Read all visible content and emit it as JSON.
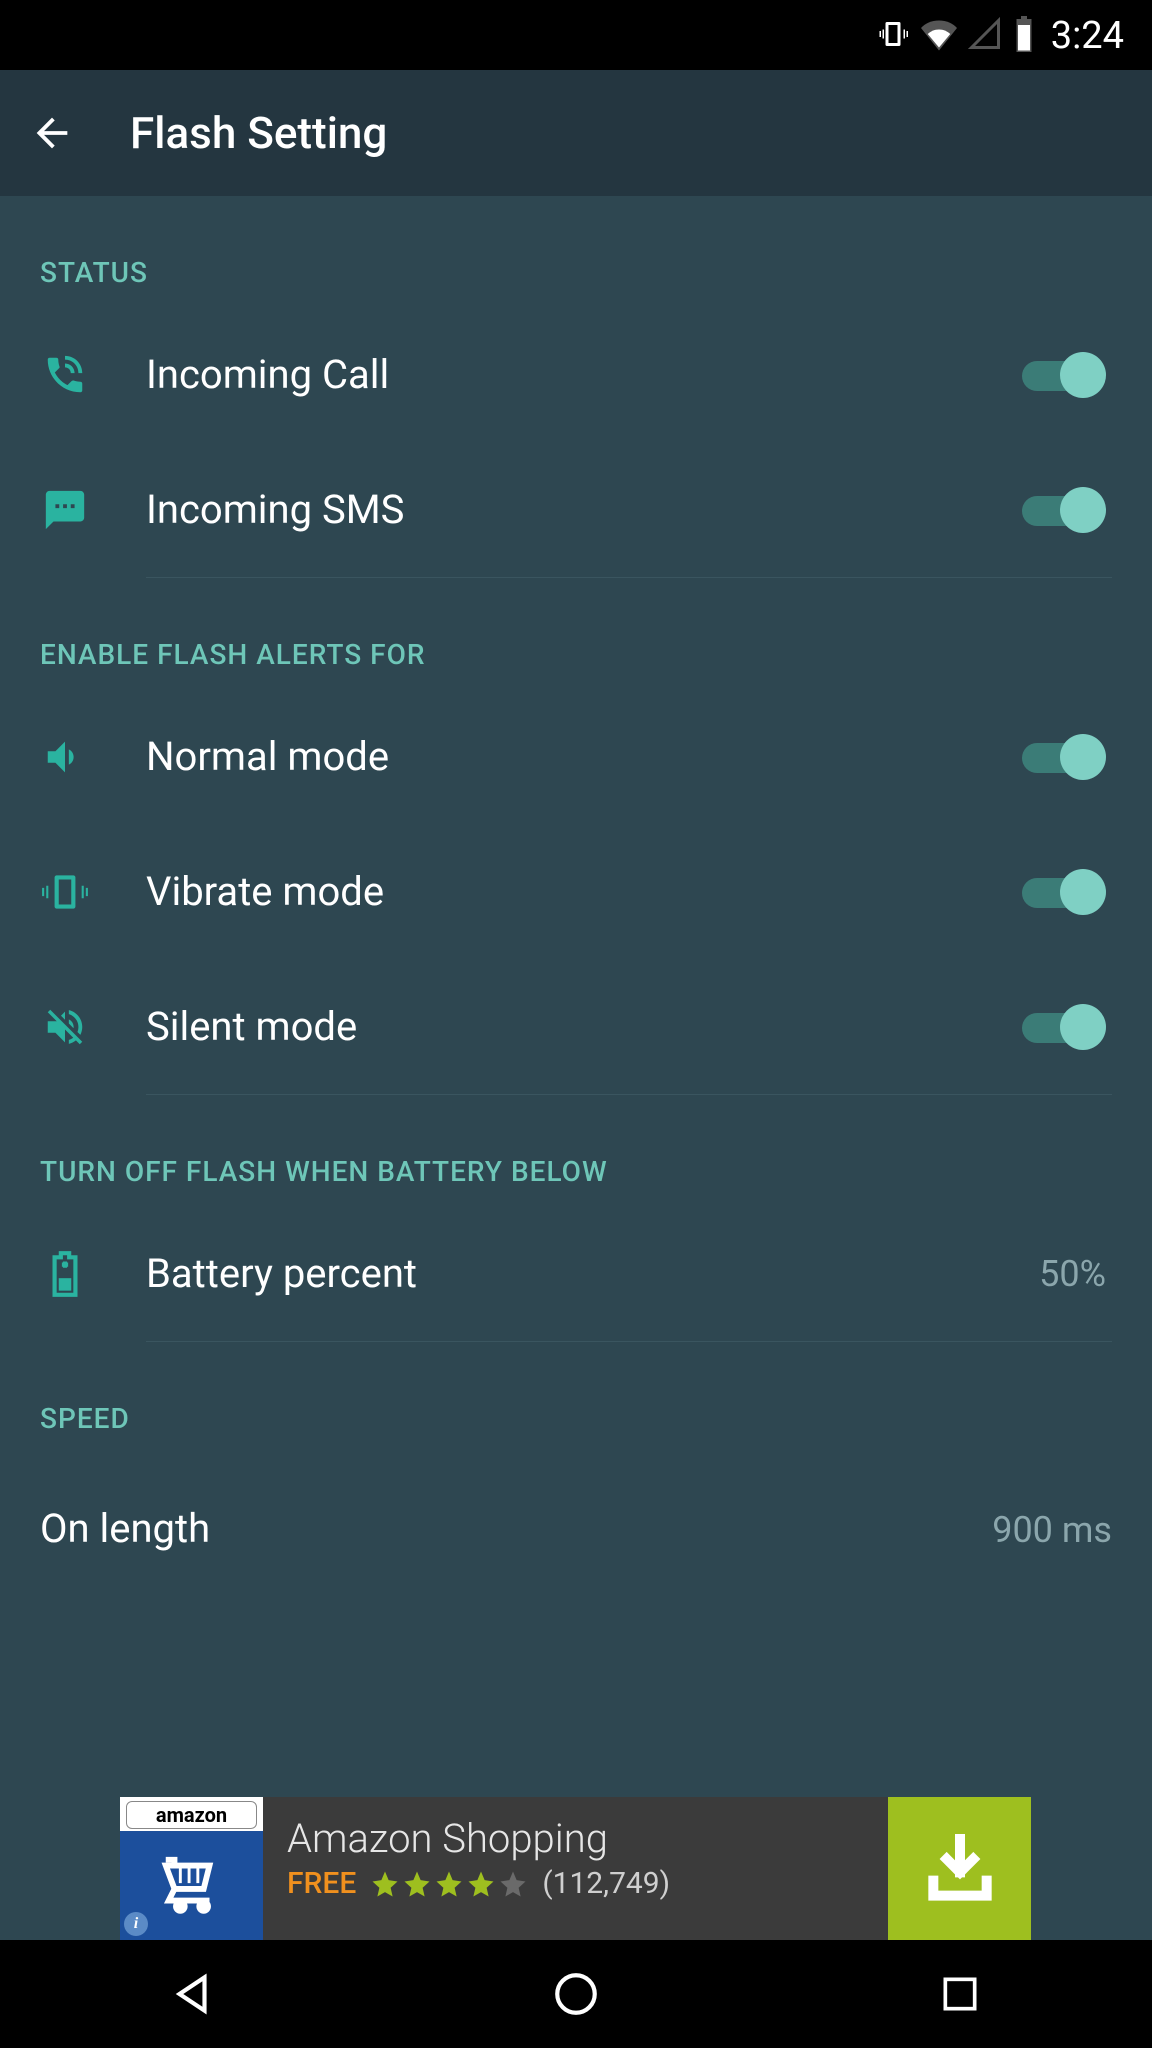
{
  "status_bar": {
    "time": "3:24"
  },
  "app_bar": {
    "title": "Flash Setting"
  },
  "sections": {
    "status": {
      "header": "STATUS",
      "items": [
        {
          "label": "Incoming Call",
          "toggled": true
        },
        {
          "label": "Incoming SMS",
          "toggled": true
        }
      ]
    },
    "enable": {
      "header": "ENABLE FLASH ALERTS FOR",
      "items": [
        {
          "label": "Normal mode",
          "toggled": true
        },
        {
          "label": "Vibrate mode",
          "toggled": true
        },
        {
          "label": "Silent mode",
          "toggled": true
        }
      ]
    },
    "battery": {
      "header": "TURN OFF FLASH WHEN BATTERY BELOW",
      "label": "Battery percent",
      "value": "50%"
    },
    "speed": {
      "header": "SPEED",
      "on_label": "On length",
      "on_value": "900 ms"
    }
  },
  "ad": {
    "brand_text": "amazon",
    "title": "Amazon Shopping",
    "price": "FREE",
    "rating": 4,
    "reviews": "(112,749)"
  }
}
